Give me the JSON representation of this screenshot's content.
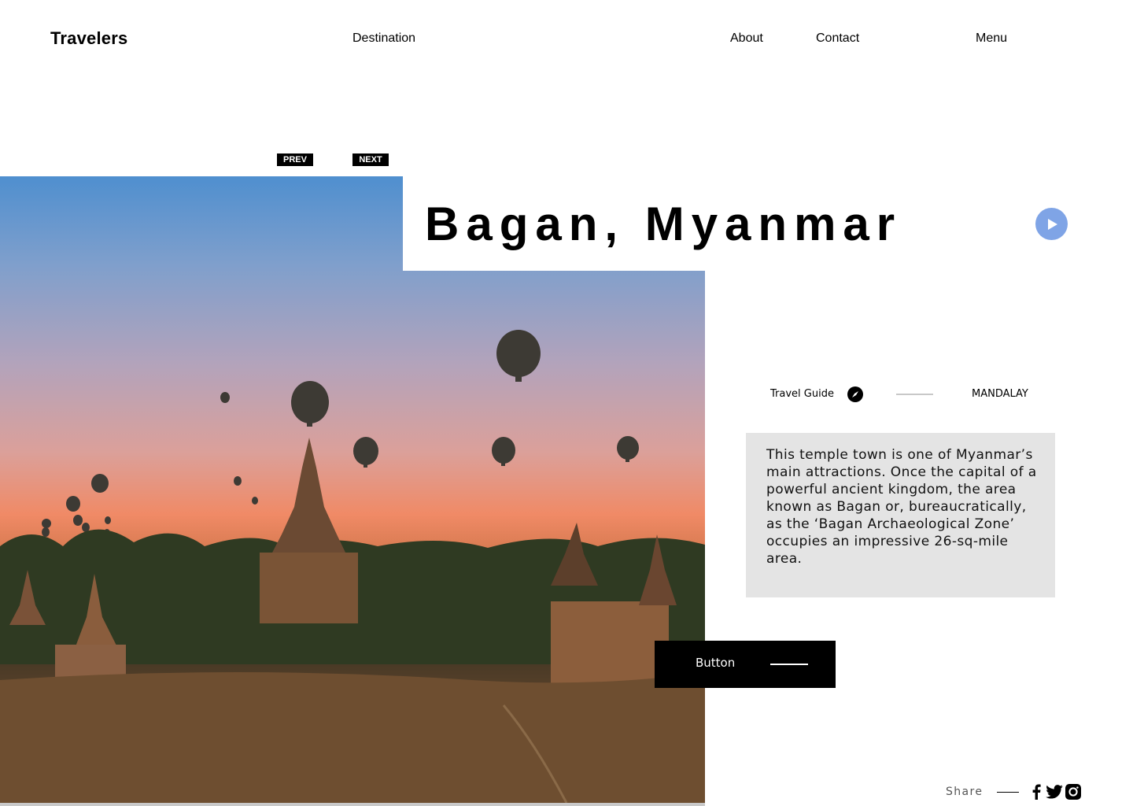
{
  "header": {
    "brand": "Travelers",
    "nav": {
      "destination": "Destination",
      "about": "About",
      "contact": "Contact",
      "menu": "Menu"
    }
  },
  "slider": {
    "prev_label": "PREV",
    "next_label": "NEXT"
  },
  "hero": {
    "title": "Bagan, Myanmar",
    "play_icon": "play-icon"
  },
  "info": {
    "guide_label": "Travel Guide",
    "guide_icon": "compass-icon",
    "region": "MANDALAY",
    "description": "This temple town is one of Myanmar’s main attractions. Once the capital of a powerful ancient kingdom, the area known as Bagan or, bureaucratically, as the ‘Bagan Archaeological Zone’ occupies an impressive 26-sq-mile area."
  },
  "cta": {
    "label": "Button"
  },
  "share": {
    "label": "Share",
    "icons": [
      "facebook-icon",
      "twitter-icon",
      "instagram-icon"
    ]
  },
  "colors": {
    "accent_play": "#7fa4e6",
    "description_bg": "#e4e4e4",
    "button_bg": "#000000"
  }
}
